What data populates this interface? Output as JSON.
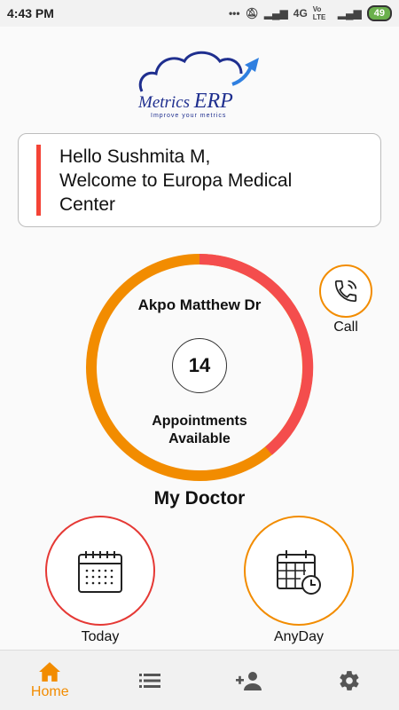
{
  "status_bar": {
    "time": "4:43 PM",
    "network": "4G",
    "carrier_badge": "Vo LTE",
    "battery": "49"
  },
  "logo": {
    "brand_prefix": "Metrics",
    "brand_suffix": "ERP",
    "tagline": "Improve your metrics",
    "colors": {
      "cloud": "#1f2f8f",
      "arrow": "#2f7fe0"
    }
  },
  "greeting": {
    "line1": "Hello Sushmita M,",
    "line2": "Welcome to Europa Medical",
    "line3": "Center",
    "accent": "#f44336"
  },
  "doctor_card": {
    "name": "Akpo Matthew Dr",
    "appointments": "14",
    "label_line1": "Appointments",
    "label_line2": "Available",
    "ring_colors": {
      "primary": "#f28c00",
      "secondary": "#f44d4d"
    }
  },
  "call": {
    "label": "Call",
    "icon": "phone-icon"
  },
  "section_title": "My Doctor",
  "actions": [
    {
      "label": "Today",
      "icon": "calendar-icon",
      "color": "#e53935"
    },
    {
      "label": "AnyDay",
      "icon": "calendar-clock-icon",
      "color": "#f28c00"
    }
  ],
  "bottom_nav": [
    {
      "label": "Home",
      "icon": "home-icon",
      "active": true
    },
    {
      "label": "",
      "icon": "list-icon"
    },
    {
      "label": "",
      "icon": "add-contact-icon"
    },
    {
      "label": "",
      "icon": "gear-icon"
    }
  ],
  "accent_color": "#f28c00"
}
